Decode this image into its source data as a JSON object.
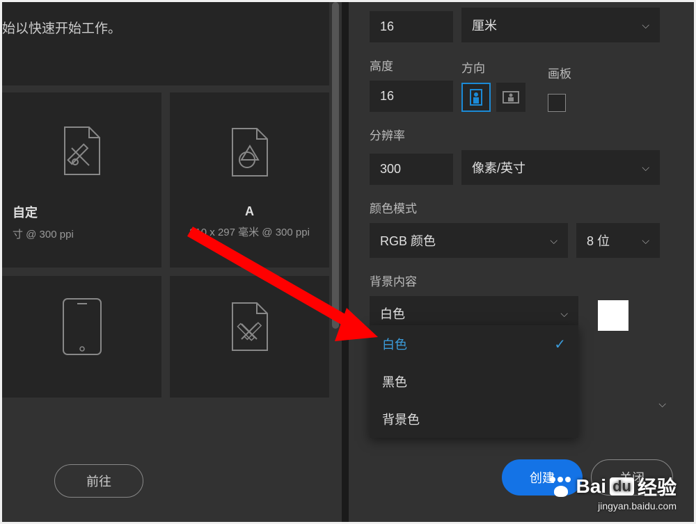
{
  "intro_text": "始以快速开始工作。",
  "presets": {
    "card1": {
      "title": "自定",
      "sub": "寸 @ 300 ppi"
    },
    "card2": {
      "title": "A",
      "sub": "210 x 297 毫米 @ 300 ppi"
    }
  },
  "goto_label": "前往",
  "form": {
    "width_value": "16",
    "unit_label": "厘米",
    "height_label": "高度",
    "height_value": "16",
    "orientation_label": "方向",
    "artboard_label": "画板",
    "resolution_label": "分辨率",
    "resolution_value": "300",
    "resolution_unit": "像素/英寸",
    "color_mode_label": "颜色模式",
    "color_mode_value": "RGB 颜色",
    "bit_depth_value": "8 位",
    "bg_content_label": "背景内容",
    "bg_content_value": "白色"
  },
  "dropdown": {
    "opt1": "白色",
    "opt2": "黑色",
    "opt3": "背景色"
  },
  "actions": {
    "create": "创建",
    "close": "关闭"
  },
  "watermark": {
    "brand": "Bai",
    "brand2": "经验",
    "url": "jingyan.baidu.com"
  }
}
